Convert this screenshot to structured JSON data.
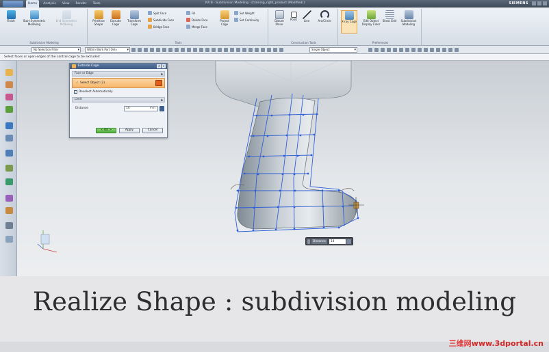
{
  "window": {
    "title": "NX 8 - Subdivision Modeling - [training_right_product (Modified)]",
    "brand": "SIEMENS",
    "tabs": [
      "Home",
      "Analysis",
      "View",
      "Render",
      "Tools"
    ],
    "active_tab": "Home"
  },
  "ribbon": {
    "groups": [
      {
        "label": "Subdivision Modeling",
        "buttons": [
          "Finish",
          "Start Symmetric Modeling",
          "End Symmetric Modeling"
        ]
      },
      {
        "label": "Tools",
        "buttons": [
          "Primitive Shape",
          "Extrude Cage",
          "Transform Cage",
          "Project Cage"
        ],
        "small": [
          "Split Face",
          "Subdivide Face",
          "Bridge Face",
          "Fill",
          "Delete Face",
          "Merge Face",
          "Set Weight",
          "Set Continuity"
        ]
      },
      {
        "label": "Construction Tools",
        "buttons": [
          "Datum Plane",
          "Point",
          "Line",
          "Arc/Circle"
        ]
      },
      {
        "label": "Preferences",
        "buttons": [
          "X-ray Cage",
          "Edit Object Display Color",
          "Show Grid",
          "Subdivision Modeling"
        ]
      }
    ]
  },
  "selection_bar": {
    "type_filter": "No Selection Filter",
    "scope": "Within Work Part Only",
    "mode": "Single Object"
  },
  "cue_line": "Select faces or open edges of the control cage to be extruded",
  "dialog": {
    "title": "Extrude Cage",
    "section_face_edge": "Face or Edge",
    "select_object": "Select Object (2)",
    "deselect_auto": "Deselect Automatically",
    "section_limit": "Limit",
    "distance_label": "Distance",
    "distance_value": "14",
    "distance_unit": "mm",
    "ok": "< OK >",
    "apply": "Apply",
    "cancel": "Cancel"
  },
  "onscreen_input": {
    "label": "Distance",
    "value": "14"
  },
  "caption": "Realize Shape : subdivision modeling",
  "watermark": {
    "cn": "三维网",
    "url": "www.3dportal.cn"
  },
  "colors": {
    "cage": "#2f5fd6",
    "model": "#a9b3bc",
    "ok": "#4fae39",
    "title": "#3d5b86"
  }
}
